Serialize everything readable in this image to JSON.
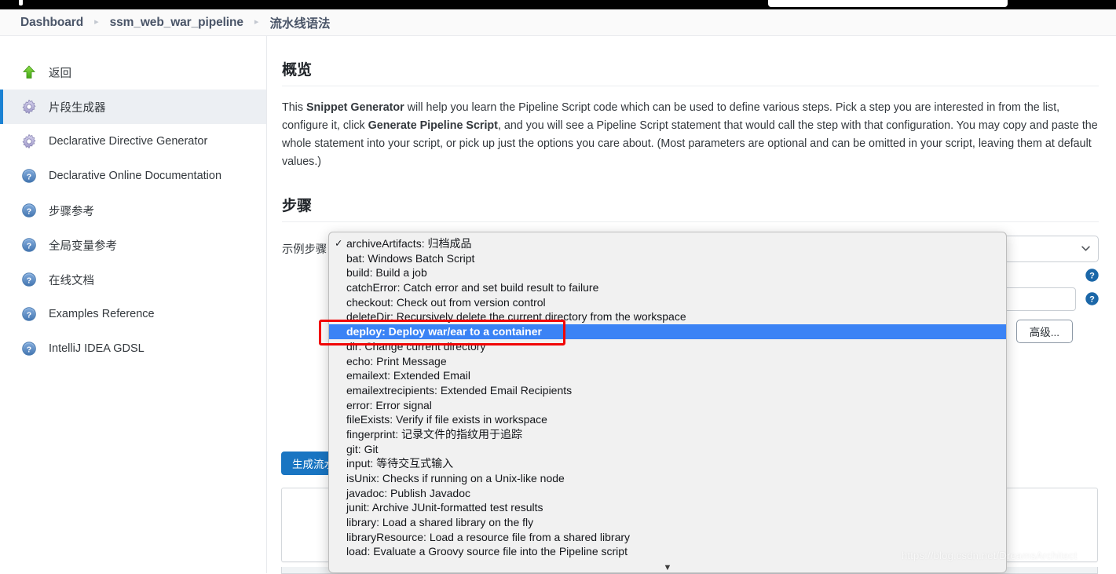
{
  "topbar": {
    "search_placeholder": ""
  },
  "breadcrumb": {
    "separator": "▸",
    "items": [
      {
        "label": "Dashboard",
        "name": "breadcrumb-dashboard"
      },
      {
        "label": "ssm_web_war_pipeline",
        "name": "breadcrumb-project"
      },
      {
        "label": "流水线语法",
        "name": "breadcrumb-pipeline-syntax"
      }
    ]
  },
  "sidebar": {
    "items": [
      {
        "label": "返回",
        "icon": "up-arrow-icon",
        "active": false
      },
      {
        "label": "片段生成器",
        "icon": "gear-icon",
        "active": true
      },
      {
        "label": "Declarative Directive Generator",
        "icon": "gear-icon",
        "active": false
      },
      {
        "label": "Declarative Online Documentation",
        "icon": "help-icon",
        "active": false
      },
      {
        "label": "步骤参考",
        "icon": "help-icon",
        "active": false
      },
      {
        "label": "全局变量参考",
        "icon": "help-icon",
        "active": false
      },
      {
        "label": "在线文档",
        "icon": "help-icon",
        "active": false
      },
      {
        "label": "Examples Reference",
        "icon": "help-icon",
        "active": false
      },
      {
        "label": "IntelliJ IDEA GDSL",
        "icon": "help-icon",
        "active": false
      }
    ]
  },
  "main": {
    "overview_title": "概览",
    "intro_1": "This ",
    "intro_b1": "Snippet Generator",
    "intro_2": " will help you learn the Pipeline Script code which can be used to define various steps. Pick a step you are interested in from the list, configure it, click ",
    "intro_b2": "Generate Pipeline Script",
    "intro_3": ", and you will see a Pipeline Script statement that would call the step with that configuration. You may copy and paste the whole statement into your script, or pick up just the options you care about. (Most parameters are optional and can be omitted in your script, leaving them at default values.)",
    "steps_title": "步骤",
    "sample_step_label": "示例步骤",
    "advanced_button": "高级...",
    "generate_button": "生成流水线脚本",
    "chevron_icon": "chevron-down-icon",
    "help_icon": "help-circle-icon"
  },
  "dropdown": {
    "check_mark": "✓",
    "scroll_arrow": "▼",
    "selected_index": 6,
    "checked_index": 0,
    "items": [
      "archiveArtifacts: 归档成品",
      "bat: Windows Batch Script",
      "build: Build a job",
      "catchError: Catch error and set build result to failure",
      "checkout: Check out from version control",
      "deleteDir: Recursively delete the current directory from the workspace",
      "deploy: Deploy war/ear to a container",
      "dir: Change current directory",
      "echo: Print Message",
      "emailext: Extended Email",
      "emailextrecipients: Extended Email Recipients",
      "error: Error signal",
      "fileExists: Verify if file exists in workspace",
      "fingerprint: 记录文件的指纹用于追踪",
      "git: Git",
      "input: 等待交互式输入",
      "isUnix: Checks if running on a Unix-like node",
      "javadoc: Publish Javadoc",
      "junit: Archive JUnit-formatted test results",
      "library: Load a shared library on the fly",
      "libraryResource: Load a resource file from a shared library",
      "load: Evaluate a Groovy source file into the Pipeline script"
    ]
  },
  "annotation": {
    "highlight_color": "#f10606"
  },
  "watermark": {
    "text": "https://blog.csdn.net/DreamsArchitect"
  }
}
